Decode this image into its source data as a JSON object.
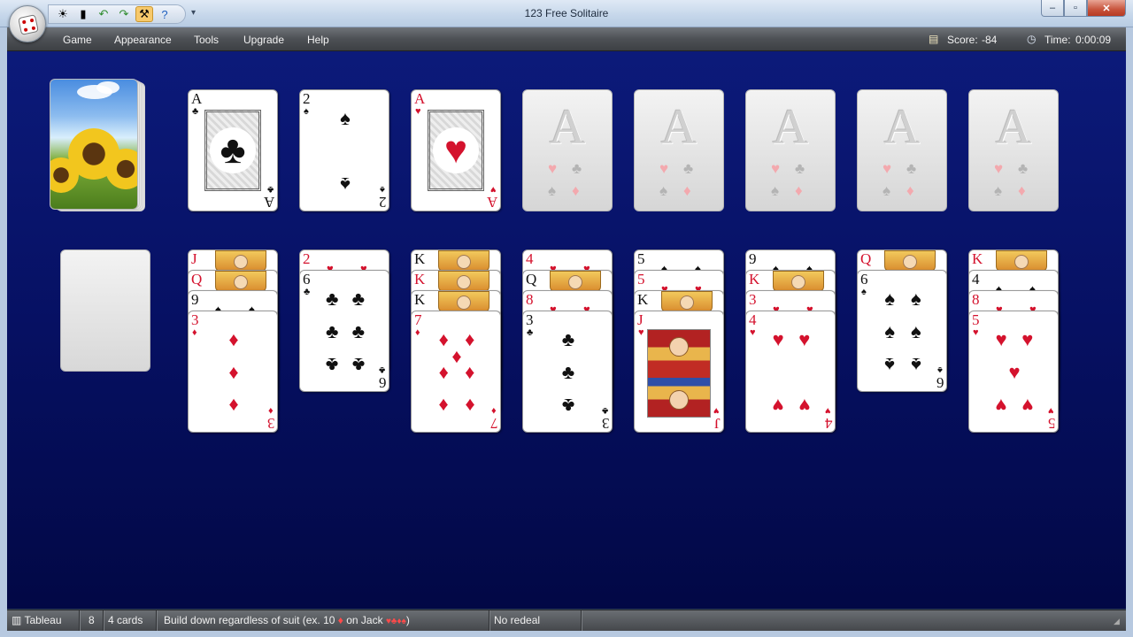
{
  "window": {
    "title": "123 Free Solitaire",
    "minimize": "–",
    "maximize": "▫",
    "close": "✕"
  },
  "quick_access": [
    "sun-icon",
    "note-icon",
    "undo-icon",
    "redo-icon",
    "hint-tool-icon",
    "help-icon"
  ],
  "menu": {
    "items": [
      "Game",
      "Appearance",
      "Tools",
      "Upgrade",
      "Help"
    ]
  },
  "status": {
    "score_label": "Score:",
    "score_value": "-84",
    "time_label": "Time:",
    "time_value": "0:00:09"
  },
  "top_row": [
    {
      "rank": "A",
      "suit": "♣",
      "color": "black",
      "type": "ace"
    },
    {
      "rank": "2",
      "suit": "♠",
      "color": "black",
      "type": "two"
    },
    {
      "rank": "A",
      "suit": "♥",
      "color": "red",
      "type": "ace"
    },
    {
      "type": "foundation",
      "label": "A"
    },
    {
      "type": "foundation",
      "label": "A"
    },
    {
      "type": "foundation",
      "label": "A"
    },
    {
      "type": "foundation",
      "label": "A"
    },
    {
      "type": "foundation",
      "label": "A"
    }
  ],
  "tableau": [
    {
      "peeks": [
        {
          "rank": "J",
          "color": "red",
          "face": true
        },
        {
          "rank": "Q",
          "color": "red",
          "face": true
        },
        {
          "rank": "9",
          "color": "black"
        }
      ],
      "top": {
        "rank": "3",
        "suit": "♦",
        "color": "red"
      }
    },
    {
      "peeks": [
        {
          "rank": "2",
          "color": "red"
        }
      ],
      "top": {
        "rank": "6",
        "suit": "♣",
        "color": "black"
      }
    },
    {
      "peeks": [
        {
          "rank": "K",
          "color": "black",
          "face": true
        },
        {
          "rank": "K",
          "color": "red",
          "face": true
        },
        {
          "rank": "K",
          "color": "black",
          "face": true
        }
      ],
      "top": {
        "rank": "7",
        "suit": "♦",
        "color": "red"
      }
    },
    {
      "peeks": [
        {
          "rank": "4",
          "color": "red"
        },
        {
          "rank": "Q",
          "color": "black",
          "face": true
        },
        {
          "rank": "8",
          "color": "red"
        }
      ],
      "top": {
        "rank": "3",
        "suit": "♣",
        "color": "black"
      }
    },
    {
      "peeks": [
        {
          "rank": "5",
          "color": "black"
        },
        {
          "rank": "5",
          "color": "red"
        },
        {
          "rank": "K",
          "color": "black",
          "face": true
        }
      ],
      "top": {
        "rank": "J",
        "suit": "♥",
        "color": "red",
        "court": true
      }
    },
    {
      "peeks": [
        {
          "rank": "9",
          "color": "black"
        },
        {
          "rank": "K",
          "color": "red",
          "face": true
        },
        {
          "rank": "3",
          "color": "red"
        }
      ],
      "top": {
        "rank": "4",
        "suit": "♥",
        "color": "red"
      }
    },
    {
      "peeks": [
        {
          "rank": "Q",
          "color": "red",
          "face": true
        }
      ],
      "top": {
        "rank": "6",
        "suit": "♠",
        "color": "black"
      }
    },
    {
      "peeks": [
        {
          "rank": "K",
          "color": "red",
          "face": true
        },
        {
          "rank": "4",
          "color": "black"
        },
        {
          "rank": "8",
          "color": "red"
        }
      ],
      "top": {
        "rank": "5",
        "suit": "♥",
        "color": "red"
      }
    }
  ],
  "statusbar": {
    "area": "Tableau",
    "count": "8",
    "cards": "4 cards",
    "rule_prefix": "Build down regardless of suit (ex. 10",
    "rule_mid_suit": "♦",
    "rule_mid": "on Jack",
    "rule_suits": "♥♣♦♠",
    "rule_suffix": ")",
    "redeal": "No redeal"
  }
}
